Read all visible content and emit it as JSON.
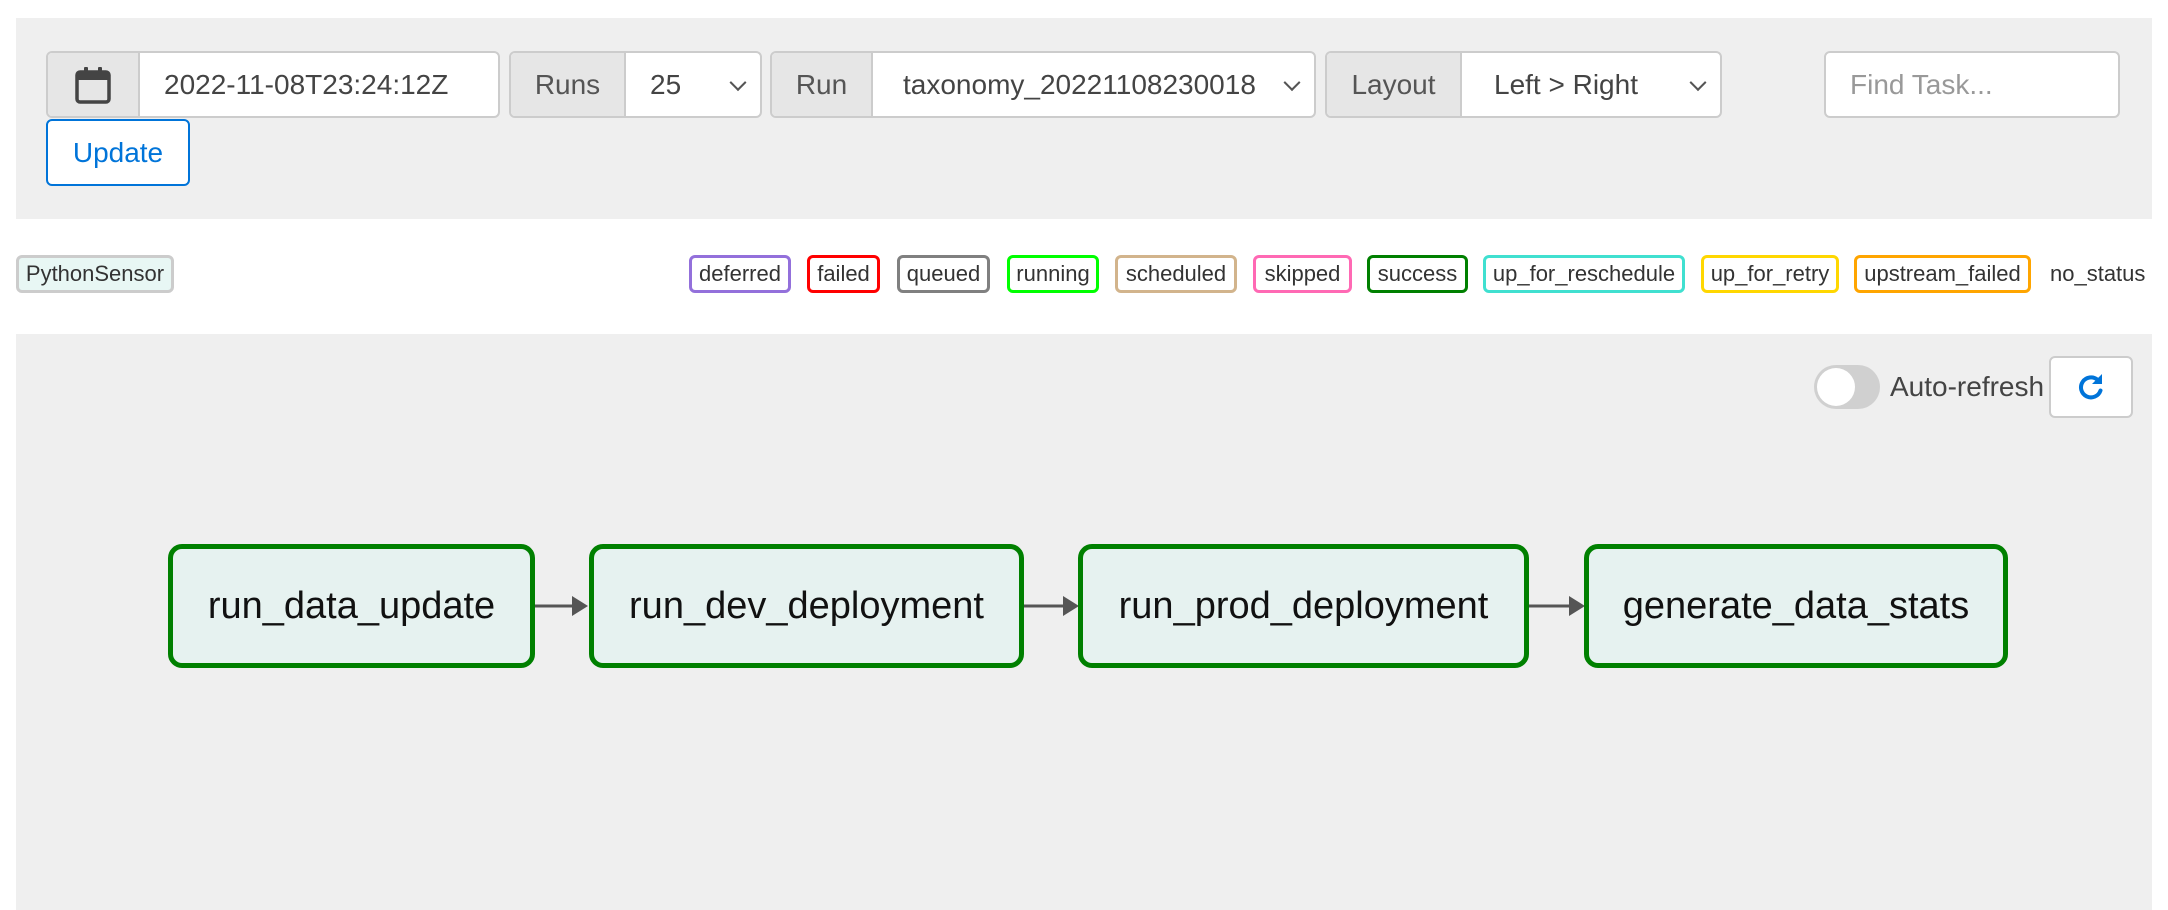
{
  "toolbar": {
    "base_date": "2022-11-08T23:24:12Z",
    "runs_label": "Runs",
    "runs_value": "25",
    "run_label": "Run",
    "run_value": "taxonomy_20221108230018",
    "layout_label": "Layout",
    "layout_value": "Left > Right",
    "search_placeholder": "Find Task...",
    "update_label": "Update"
  },
  "legend": {
    "operator": "PythonSensor",
    "states": [
      {
        "label": "deferred",
        "color": "#9370db"
      },
      {
        "label": "failed",
        "color": "#ff0000"
      },
      {
        "label": "queued",
        "color": "#808080"
      },
      {
        "label": "running",
        "color": "#00ff00"
      },
      {
        "label": "scheduled",
        "color": "#d2b48c"
      },
      {
        "label": "skipped",
        "color": "#ff69b4"
      },
      {
        "label": "success",
        "color": "#008000"
      },
      {
        "label": "up_for_reschedule",
        "color": "#40e0d0"
      },
      {
        "label": "up_for_retry",
        "color": "#ffd700"
      },
      {
        "label": "upstream_failed",
        "color": "#ffa500"
      }
    ],
    "no_status": "no_status"
  },
  "graph": {
    "auto_refresh_label": "Auto-refresh",
    "auto_refresh_on": false,
    "refresh_icon": "refresh-icon",
    "tasks": [
      {
        "id": "run_data_update",
        "state": "success"
      },
      {
        "id": "run_dev_deployment",
        "state": "success"
      },
      {
        "id": "run_prod_deployment",
        "state": "success"
      },
      {
        "id": "generate_data_stats",
        "state": "success"
      }
    ]
  },
  "colors": {
    "primary": "#0074d9",
    "success": "#008000",
    "node_fill": "#e6f2f0",
    "panel_bg": "#efefef"
  }
}
